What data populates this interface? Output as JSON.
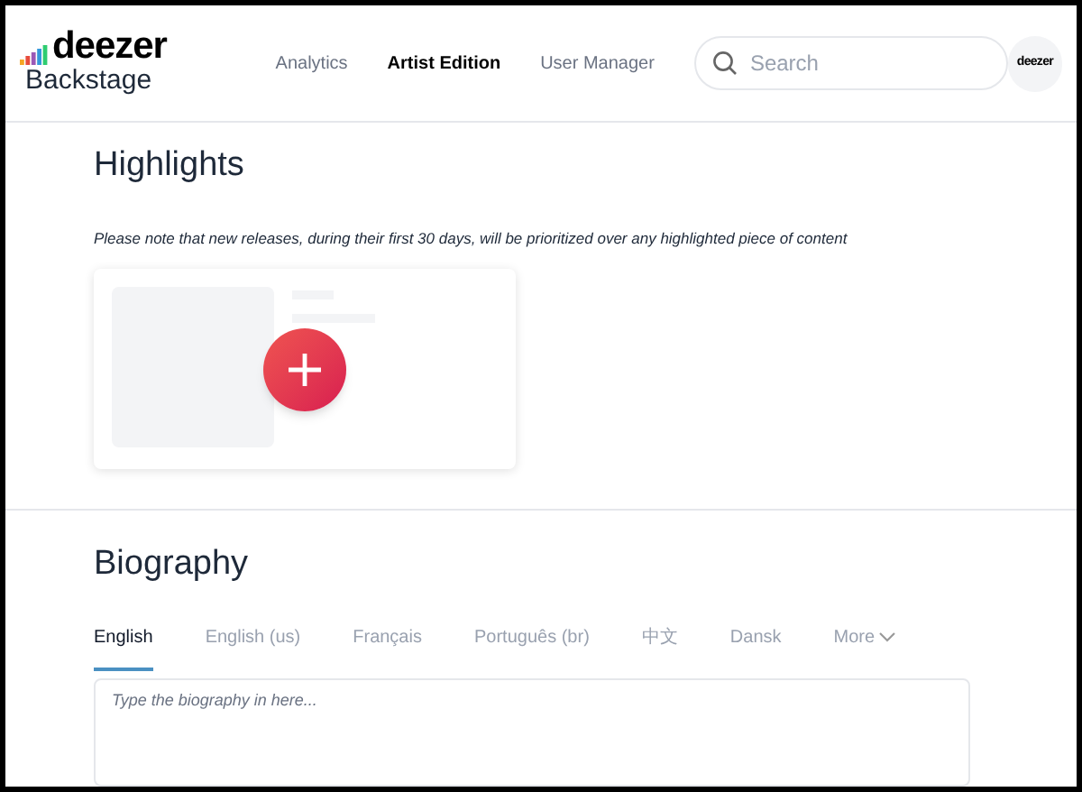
{
  "header": {
    "logo": "deezer",
    "product": "Backstage",
    "nav": [
      {
        "label": "Analytics",
        "selected": false
      },
      {
        "label": "Artist Edition",
        "selected": true
      },
      {
        "label": "User Manager",
        "selected": false
      }
    ],
    "search": {
      "placeholder": "Search"
    },
    "avatar": "deezer"
  },
  "highlights": {
    "title": "Highlights",
    "note": "Please note that new releases, during their first 30 days, will be prioritized over any highlighted piece of content"
  },
  "biography": {
    "title": "Biography",
    "tabs": [
      {
        "label": "English",
        "selected": true
      },
      {
        "label": "English (us)",
        "selected": false
      },
      {
        "label": "Français",
        "selected": false
      },
      {
        "label": "Português (br)",
        "selected": false
      },
      {
        "label": "中文",
        "selected": false
      },
      {
        "label": "Dansk",
        "selected": false
      },
      {
        "label": "More",
        "selected": false,
        "kind": "dropdown"
      }
    ],
    "editor": {
      "placeholder": "Type the biography in here..."
    }
  }
}
